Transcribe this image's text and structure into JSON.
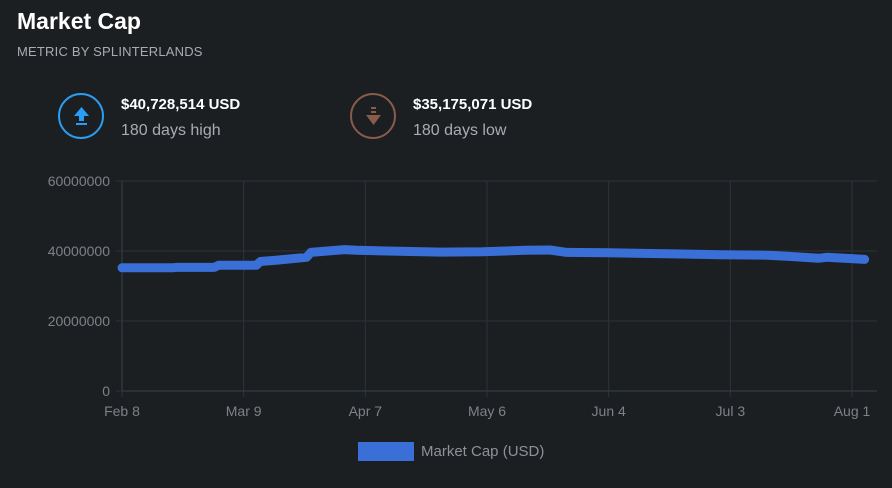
{
  "header": {
    "title": "Market Cap",
    "subtitle": "METRIC BY SPLINTERLANDS"
  },
  "stats": {
    "high": {
      "value": "$40,728,514 USD",
      "label": "180 days high",
      "icon": "arrow-up-icon",
      "color": "#2a9df4"
    },
    "low": {
      "value": "$35,175,071 USD",
      "label": "180 days low",
      "icon": "arrow-down-icon",
      "color": "#8a5a4a"
    }
  },
  "colors": {
    "background": "#1c1f22",
    "series": "#3a6fd8",
    "grid": "#2e3338",
    "tick_text": "#7d8287"
  },
  "chart_data": {
    "type": "line",
    "xlabel": "",
    "ylabel": "",
    "ylim": [
      0,
      60000000
    ],
    "y_ticks": [
      {
        "value": 0,
        "label": "0"
      },
      {
        "value": 20000000,
        "label": "20000000"
      },
      {
        "value": 40000000,
        "label": "40000000"
      },
      {
        "value": 60000000,
        "label": "60000000"
      }
    ],
    "x_ticks": [
      {
        "date": "2022-02-08",
        "label": "Feb 8"
      },
      {
        "date": "2022-03-09",
        "label": "Mar 9"
      },
      {
        "date": "2022-04-07",
        "label": "Apr 7"
      },
      {
        "date": "2022-05-06",
        "label": "May 6"
      },
      {
        "date": "2022-06-04",
        "label": "Jun 4"
      },
      {
        "date": "2022-07-03",
        "label": "Jul 3"
      },
      {
        "date": "2022-08-01",
        "label": "Aug 1"
      }
    ],
    "x_range": [
      "2022-02-08",
      "2022-08-01"
    ],
    "grid": true,
    "legend_position": "bottom",
    "series": [
      {
        "name": "Market Cap (USD)",
        "x": [
          "2022-02-08",
          "2022-02-20",
          "2022-02-21",
          "2022-03-02",
          "2022-03-03",
          "2022-03-12",
          "2022-03-13",
          "2022-03-17",
          "2022-03-24",
          "2022-03-25",
          "2022-04-02",
          "2022-04-05",
          "2022-04-15",
          "2022-04-25",
          "2022-05-05",
          "2022-05-15",
          "2022-05-21",
          "2022-05-25",
          "2022-06-04",
          "2022-06-18",
          "2022-07-01",
          "2022-07-12",
          "2022-07-18",
          "2022-07-24",
          "2022-07-26",
          "2022-08-04"
        ],
        "values": [
          35200000,
          35200000,
          35300000,
          35300000,
          35900000,
          35900000,
          37000000,
          37400000,
          38200000,
          39600000,
          40400000,
          40200000,
          39900000,
          39700000,
          39800000,
          40200000,
          40300000,
          39600000,
          39500000,
          39200000,
          38900000,
          38800000,
          38400000,
          37900000,
          38200000,
          37600000
        ]
      }
    ]
  },
  "legend": {
    "label": "Market Cap (USD)"
  }
}
